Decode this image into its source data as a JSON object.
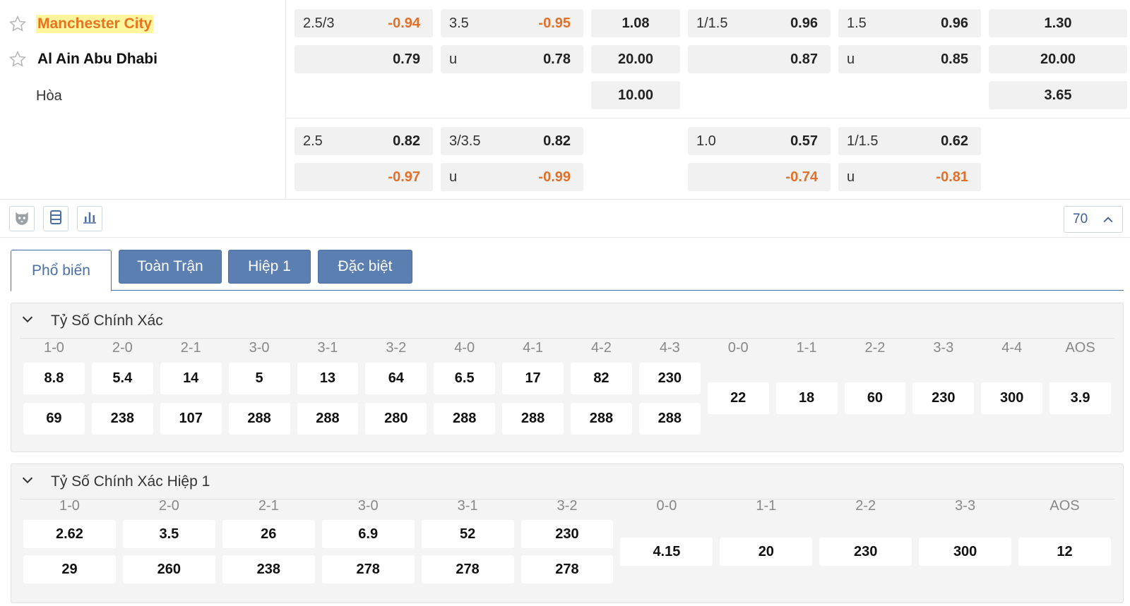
{
  "teams": {
    "home": "Manchester City",
    "away": "Al Ain Abu Dhabi",
    "draw": "Hòa"
  },
  "match_odds": {
    "full": {
      "handicap": {
        "line": "2.5/3",
        "home": "-0.94",
        "away": "0.79"
      },
      "overunder": {
        "line": "3.5",
        "over": "-0.95",
        "under_label": "u",
        "under": "0.78"
      },
      "x12": {
        "home": "1.08",
        "away": "20.00",
        "draw": "10.00"
      },
      "ht_handicap": {
        "line": "1/1.5",
        "home": "0.96",
        "away": "0.87"
      },
      "ht_overunder": {
        "line": "1.5",
        "over": "0.96",
        "under_label": "u",
        "under": "0.85"
      },
      "ht_x12": {
        "home": "1.30",
        "away": "20.00",
        "draw": "3.65"
      }
    },
    "alt": {
      "handicap": {
        "line": "2.5",
        "home": "0.82",
        "away": "-0.97"
      },
      "overunder": {
        "line": "3/3.5",
        "over": "0.82",
        "under_label": "u",
        "under": "-0.99"
      },
      "ht_handicap": {
        "line": "1.0",
        "home": "0.57",
        "away": "-0.74"
      },
      "ht_overunder": {
        "line": "1/1.5",
        "over": "0.62",
        "under_label": "u",
        "under": "-0.81"
      }
    }
  },
  "toolbar": {
    "market_count": "70",
    "icons": [
      "animation-icon",
      "list-icon",
      "stats-icon"
    ]
  },
  "tabs": [
    "Phổ biến",
    "Toàn Trận",
    "Hiệp 1",
    "Đặc biệt"
  ],
  "correct_score": {
    "title": "Tỷ Số Chính Xác",
    "win_scores": [
      "1-0",
      "2-0",
      "2-1",
      "3-0",
      "3-1",
      "3-2",
      "4-0",
      "4-1",
      "4-2",
      "4-3"
    ],
    "home_odds": [
      "8.8",
      "5.4",
      "14",
      "5",
      "13",
      "64",
      "6.5",
      "17",
      "82",
      "230"
    ],
    "away_odds": [
      "69",
      "238",
      "107",
      "288",
      "288",
      "280",
      "288",
      "288",
      "288",
      "288"
    ],
    "draw_scores": [
      "0-0",
      "1-1",
      "2-2",
      "3-3",
      "4-4",
      "AOS"
    ],
    "draw_odds": [
      "22",
      "18",
      "60",
      "230",
      "300",
      "3.9"
    ]
  },
  "correct_score_ht": {
    "title": "Tỷ Số Chính Xác Hiệp 1",
    "win_scores": [
      "1-0",
      "2-0",
      "2-1",
      "3-0",
      "3-1",
      "3-2"
    ],
    "home_odds": [
      "2.62",
      "3.5",
      "26",
      "6.9",
      "52",
      "230"
    ],
    "away_odds": [
      "29",
      "260",
      "238",
      "278",
      "278",
      "278"
    ],
    "draw_scores": [
      "0-0",
      "1-1",
      "2-2",
      "3-3",
      "AOS"
    ],
    "draw_odds": [
      "4.15",
      "20",
      "230",
      "300",
      "12"
    ]
  },
  "colors": {
    "accent": "#5a7fb0",
    "negative": "#e0702a",
    "highlight": "#fff59d"
  }
}
